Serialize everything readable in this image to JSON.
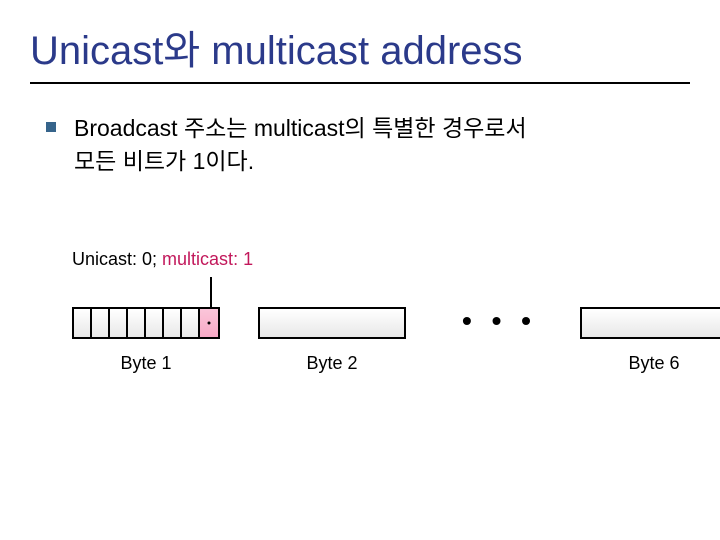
{
  "title": "Unicast와 multicast address",
  "bullet": {
    "line1": "Broadcast 주소는 multicast의 특별한 경우로서",
    "line2": "모든 비트가 1이다."
  },
  "diagram": {
    "bit_label_unicast": "Unicast: 0; ",
    "bit_label_multicast": "multicast: 1",
    "byte1_caption": "Byte 1",
    "byte2_caption": "Byte 2",
    "byte6_caption": "Byte 6",
    "ellipsis": "• • •"
  }
}
